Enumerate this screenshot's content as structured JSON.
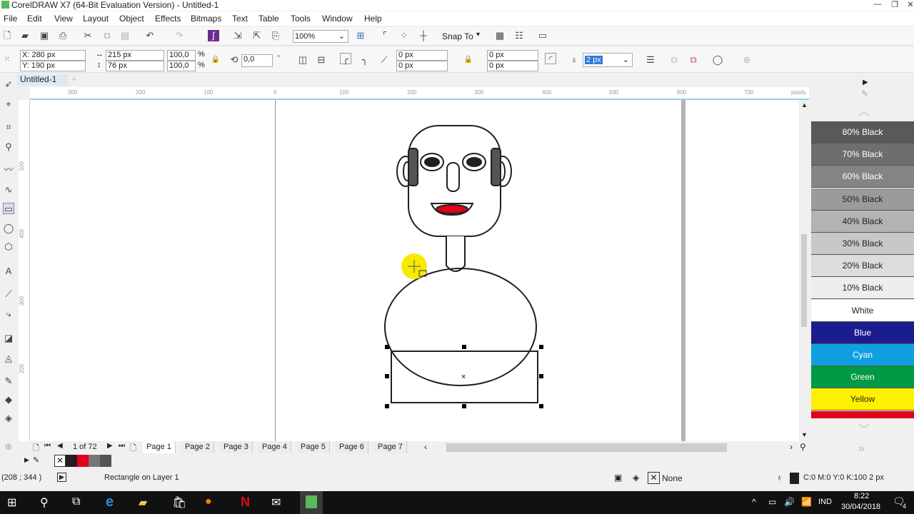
{
  "app": {
    "title": "CorelDRAW X7 (64-Bit Evaluation Version) - Untitled-1",
    "document_tab": "Untitled-1"
  },
  "menu": [
    "File",
    "Edit",
    "View",
    "Layout",
    "Object",
    "Effects",
    "Bitmaps",
    "Text",
    "Table",
    "Tools",
    "Window",
    "Help"
  ],
  "toolbar": {
    "zoom": "100%",
    "snap_to": "Snap To"
  },
  "property_bar": {
    "x": "X: 280 px",
    "y": "Y: 190 px",
    "width": "215 px",
    "height": "76 px",
    "scale_x": "100,0",
    "scale_y": "100,0",
    "pct": "%",
    "rotation": "0,0",
    "corner_1": "0 px",
    "corner_2": "0 px",
    "corner_3": "0 px",
    "corner_4": "0 px",
    "outline_width": "2 px"
  },
  "ruler": {
    "top": [
      "300",
      "200",
      "100",
      "0",
      "100",
      "200",
      "300",
      "400",
      "500",
      "600",
      "700"
    ],
    "unit": "pixels",
    "left": [
      "500",
      "400",
      "300",
      "200"
    ]
  },
  "pages": {
    "counter": "1 of 72",
    "tabs": [
      "Page 1",
      "Page 2",
      "Page 3",
      "Page 4",
      "Page 5",
      "Page 6",
      "Page 7"
    ]
  },
  "status": {
    "coords": "(208 ; 344 )",
    "object": "Rectangle on Layer 1",
    "fill": "None",
    "outline": "C:0 M:0 Y:0 K:100  2 px"
  },
  "palette": [
    {
      "name": "80% Black",
      "bg": "#5a5958",
      "fg": "#ffffff"
    },
    {
      "name": "70% Black",
      "bg": "#6f6e6d",
      "fg": "#ffffff"
    },
    {
      "name": "60% Black",
      "bg": "#858483",
      "fg": "#ffffff"
    },
    {
      "name": "50% Black",
      "bg": "#9c9b9b",
      "fg": "#222222"
    },
    {
      "name": "40% Black",
      "bg": "#b3b3b3",
      "fg": "#222222"
    },
    {
      "name": "30% Black",
      "bg": "#c8c8c8",
      "fg": "#222222"
    },
    {
      "name": "20% Black",
      "bg": "#dcdcdc",
      "fg": "#222222"
    },
    {
      "name": "10% Black",
      "bg": "#eeeeee",
      "fg": "#222222"
    },
    {
      "name": "White",
      "bg": "#ffffff",
      "fg": "#222222"
    },
    {
      "name": "Blue",
      "bg": "#1c1d8c",
      "fg": "#ffffff"
    },
    {
      "name": "Cyan",
      "bg": "#0ea0e0",
      "fg": "#ffffff"
    },
    {
      "name": "Green",
      "bg": "#009a44",
      "fg": "#ffffff"
    },
    {
      "name": "Yellow",
      "bg": "#fff000",
      "fg": "#222222"
    }
  ],
  "taskbar": {
    "lang": "IND",
    "time": "8:22",
    "date": "30/04/2018",
    "notifications": "4"
  },
  "colors": {
    "accent": "#8fd3ea",
    "mouth": "#e2001a",
    "hair": "#555555",
    "cursor_highlight": "#f5ea00"
  }
}
